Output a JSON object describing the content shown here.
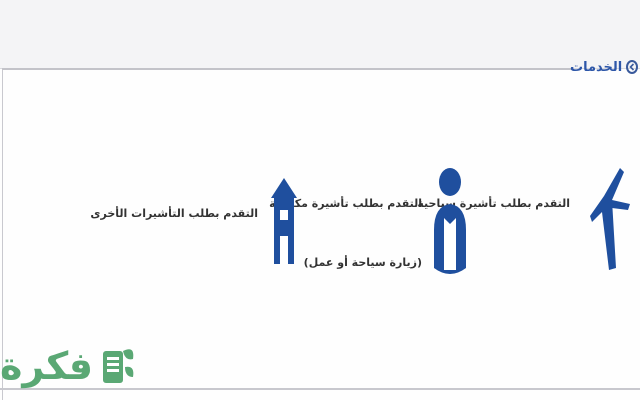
{
  "services_heading": {
    "title": "الخدمات",
    "icon": "chevron-right-circle-icon"
  },
  "services": [
    {
      "id": "tourist-visa",
      "icon": "airplane-icon",
      "label": "التقدم بطلب تأشيرة سياحية"
    },
    {
      "id": "family-visa",
      "icon": "person-icon",
      "label": "التقدم بطلب تأشيرة مكفولة",
      "sub_label": "(زيارة سياحة أو عمل)"
    },
    {
      "id": "other-visas",
      "icon": "house-icon",
      "label": "التقدم بطلب التأشيرات الأخرى"
    }
  ],
  "watermark": {
    "text": "فكرة",
    "icon": "book-leaf-icon"
  },
  "colors": {
    "icon_blue": "#1f4f9e",
    "heading_blue": "#2d56a8",
    "watermark_green": "#5aa874"
  }
}
